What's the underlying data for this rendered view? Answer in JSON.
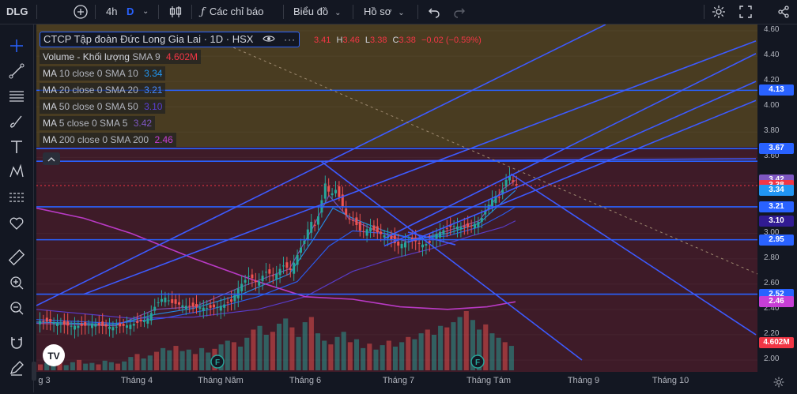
{
  "topbar": {
    "symbol": "DLG",
    "interval": "4h",
    "interval_flag": "D",
    "indicators": "Các chỉ báo",
    "chart_type": "Biểu đồ",
    "profile": "Hồ sơ"
  },
  "legend": {
    "title": "CTCP Tập đoàn Đức Long Gia Lai · 1D · HSX",
    "ohlc": {
      "o_value": "3.41",
      "h_label": "H",
      "h_value": "3.46",
      "l_label": "L",
      "l_value": "3.38",
      "c_label": "C",
      "c_value": "3.38",
      "change": "−0.02 (−0.59%)"
    },
    "indicators": [
      {
        "name": "Volume - Khối lượng",
        "params": "SMA 9",
        "value": "4.602M",
        "color": "#f23645"
      },
      {
        "name": "MA",
        "params": "10 close 0 SMA 10",
        "value": "3.34",
        "color": "#2196f3"
      },
      {
        "name": "MA",
        "params": "20 close 0 SMA 20",
        "value": "3.21",
        "color": "#2962ff"
      },
      {
        "name": "MA",
        "params": "50 close 0 SMA 50",
        "value": "3.10",
        "color": "#5b3fd6"
      },
      {
        "name": "MA",
        "params": "5 close 0 SMA 5",
        "value": "3.42",
        "color": "#7e57c2"
      },
      {
        "name": "MA",
        "params": "200 close 0 SMA 200",
        "value": "2.46",
        "color": "#c73ed6"
      }
    ],
    "collapse_icon": "chevron-up-icon"
  },
  "price_axis": {
    "ticks": [
      "4.60",
      "4.40",
      "4.20",
      "4.00",
      "3.80",
      "3.60",
      "3.00",
      "2.80",
      "2.60",
      "2.40",
      "2.20",
      "2.00"
    ],
    "labels": [
      {
        "text": "4.13",
        "bg": "#2962ff",
        "fg": "#ffffff"
      },
      {
        "text": "3.67",
        "bg": "#2962ff",
        "fg": "#ffffff"
      },
      {
        "text": "3.42",
        "bg": "#7e57c2",
        "fg": "#ffffff"
      },
      {
        "text": "3.38",
        "bg": "#f23645",
        "fg": "#ffffff"
      },
      {
        "text": "3.34",
        "bg": "#2196f3",
        "fg": "#ffffff"
      },
      {
        "text": "3.21",
        "bg": "#2962ff",
        "fg": "#ffffff"
      },
      {
        "text": "3.10",
        "bg": "#311b92",
        "fg": "#ffffff"
      },
      {
        "text": "2.95",
        "bg": "#2962ff",
        "fg": "#ffffff"
      },
      {
        "text": "2.52",
        "bg": "#2962ff",
        "fg": "#ffffff"
      },
      {
        "text": "2.46",
        "bg": "#c73ed6",
        "fg": "#ffffff"
      },
      {
        "text": "4.602M",
        "bg": "#f23645",
        "fg": "#ffffff"
      }
    ]
  },
  "time_axis": [
    "g 3",
    "Tháng 4",
    "Tháng Năm",
    "Tháng 6",
    "Tháng 7",
    "Tháng Tám",
    "Tháng 9",
    "Tháng 10"
  ],
  "watermark": "TV",
  "event_marker": "F",
  "chart_data": {
    "type": "candlestick",
    "symbol": "DLG",
    "last_close": 3.38,
    "ylim": [
      2.0,
      4.6
    ],
    "horizontal_levels": [
      4.13,
      3.67,
      3.21,
      2.95,
      2.52
    ],
    "ohlc_last": {
      "o": 3.41,
      "h": 3.46,
      "l": 3.38,
      "c": 3.38
    },
    "price_path": [
      [
        0,
        2.31
      ],
      [
        20,
        2.3
      ],
      [
        40,
        2.27
      ],
      [
        60,
        2.27
      ],
      [
        70,
        2.29
      ],
      [
        80,
        2.27
      ],
      [
        95,
        2.26
      ],
      [
        110,
        2.27
      ],
      [
        125,
        2.29
      ],
      [
        140,
        2.33
      ],
      [
        150,
        2.44
      ],
      [
        160,
        2.5
      ],
      [
        170,
        2.45
      ],
      [
        185,
        2.43
      ],
      [
        200,
        2.42
      ],
      [
        215,
        2.41
      ],
      [
        228,
        2.42
      ],
      [
        245,
        2.46
      ],
      [
        255,
        2.58
      ],
      [
        268,
        2.67
      ],
      [
        278,
        2.6
      ],
      [
        288,
        2.7
      ],
      [
        300,
        2.66
      ],
      [
        310,
        2.75
      ],
      [
        320,
        2.71
      ],
      [
        330,
        2.85
      ],
      [
        338,
        2.95
      ],
      [
        345,
        3.1
      ],
      [
        352,
        3.05
      ],
      [
        358,
        3.22
      ],
      [
        364,
        3.4
      ],
      [
        370,
        3.3
      ],
      [
        378,
        3.35
      ],
      [
        385,
        3.22
      ],
      [
        392,
        3.12
      ],
      [
        400,
        3.1
      ],
      [
        410,
        3.0
      ],
      [
        420,
        3.05
      ],
      [
        432,
        3.0
      ],
      [
        445,
        2.97
      ],
      [
        455,
        2.9
      ],
      [
        465,
        2.93
      ],
      [
        475,
        2.95
      ],
      [
        485,
        2.91
      ],
      [
        495,
        2.92
      ],
      [
        505,
        3.0
      ],
      [
        515,
        3.03
      ],
      [
        525,
        3.06
      ],
      [
        535,
        3.05
      ],
      [
        545,
        3.05
      ],
      [
        560,
        3.1
      ],
      [
        570,
        3.22
      ],
      [
        578,
        3.3
      ],
      [
        585,
        3.28
      ],
      [
        592,
        3.42
      ],
      [
        597,
        3.45
      ],
      [
        602,
        3.4
      ],
      [
        606,
        3.38
      ]
    ],
    "sma_paths": {
      "sma5": [
        [
          0,
          2.29
        ],
        [
          100,
          2.27
        ],
        [
          150,
          2.4
        ],
        [
          200,
          2.42
        ],
        [
          260,
          2.58
        ],
        [
          320,
          2.72
        ],
        [
          350,
          3.05
        ],
        [
          370,
          3.3
        ],
        [
          395,
          3.12
        ],
        [
          430,
          3.02
        ],
        [
          470,
          2.93
        ],
        [
          510,
          3.0
        ],
        [
          560,
          3.1
        ],
        [
          590,
          3.35
        ],
        [
          606,
          3.42
        ]
      ],
      "sma10": [
        [
          0,
          2.3
        ],
        [
          100,
          2.28
        ],
        [
          150,
          2.36
        ],
        [
          200,
          2.41
        ],
        [
          260,
          2.52
        ],
        [
          320,
          2.68
        ],
        [
          350,
          2.95
        ],
        [
          375,
          3.2
        ],
        [
          400,
          3.12
        ],
        [
          440,
          3.02
        ],
        [
          480,
          2.95
        ],
        [
          520,
          3.0
        ],
        [
          560,
          3.08
        ],
        [
          590,
          3.25
        ],
        [
          606,
          3.34
        ]
      ],
      "sma20": [
        [
          0,
          2.32
        ],
        [
          100,
          2.29
        ],
        [
          160,
          2.33
        ],
        [
          220,
          2.4
        ],
        [
          280,
          2.5
        ],
        [
          330,
          2.62
        ],
        [
          370,
          2.9
        ],
        [
          400,
          3.02
        ],
        [
          440,
          3.0
        ],
        [
          480,
          2.96
        ],
        [
          520,
          2.98
        ],
        [
          560,
          3.05
        ],
        [
          590,
          3.15
        ],
        [
          606,
          3.21
        ]
      ],
      "sma50": [
        [
          0,
          2.4
        ],
        [
          120,
          2.33
        ],
        [
          200,
          2.34
        ],
        [
          280,
          2.4
        ],
        [
          340,
          2.5
        ],
        [
          400,
          2.7
        ],
        [
          450,
          2.8
        ],
        [
          500,
          2.88
        ],
        [
          550,
          2.98
        ],
        [
          590,
          3.05
        ],
        [
          606,
          3.1
        ]
      ],
      "sma200": [
        [
          0,
          3.2
        ],
        [
          60,
          3.12
        ],
        [
          120,
          3.0
        ],
        [
          200,
          2.8
        ],
        [
          280,
          2.62
        ],
        [
          340,
          2.5
        ],
        [
          400,
          2.48
        ],
        [
          460,
          2.42
        ],
        [
          520,
          2.4
        ],
        [
          570,
          2.42
        ],
        [
          606,
          2.46
        ]
      ]
    },
    "trendlines": [
      [
        [
          0,
          2.43
        ],
        [
          720,
          4.65
        ]
      ],
      [
        [
          60,
          2.52
        ],
        [
          910,
          4.52
        ]
      ],
      [
        [
          440,
          2.96
        ],
        [
          910,
          4.42
        ]
      ],
      [
        [
          440,
          2.9
        ],
        [
          910,
          4.2
        ]
      ],
      [
        [
          470,
          2.93
        ],
        [
          910,
          4.05
        ]
      ],
      [
        [
          365,
          3.57
        ],
        [
          910,
          3.59
        ]
      ],
      [
        [
          360,
          3.57
        ],
        [
          690,
          2.0
        ]
      ],
      [
        [
          600,
          3.47
        ],
        [
          910,
          2.2
        ]
      ],
      [
        [
          470,
          3.01
        ],
        [
          530,
          2.91
        ]
      ]
    ],
    "dashed_trendline": [
      [
        230,
        4.52
      ],
      [
        912,
        2.68
      ]
    ],
    "volume_bars": [
      8,
      10,
      9,
      12,
      7,
      11,
      14,
      9,
      10,
      8,
      13,
      11,
      9,
      12,
      18,
      22,
      16,
      20,
      25,
      30,
      27,
      33,
      26,
      28,
      22,
      30,
      24,
      29,
      35,
      40,
      38,
      32,
      44,
      55,
      60,
      48,
      52,
      63,
      70,
      58,
      45,
      65,
      72,
      50,
      40,
      35,
      45,
      52,
      38,
      42,
      30,
      36,
      28,
      34,
      40,
      32,
      38,
      45,
      42,
      50,
      55,
      48,
      60,
      58,
      65,
      72,
      80,
      68,
      55,
      62,
      50,
      44,
      38,
      33
    ]
  }
}
